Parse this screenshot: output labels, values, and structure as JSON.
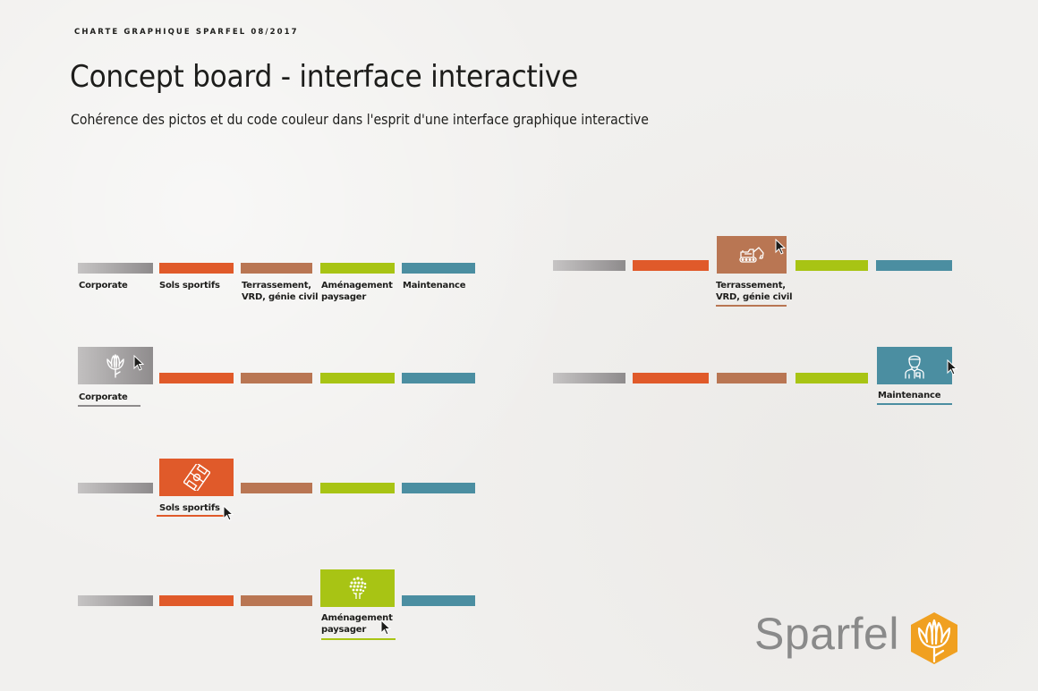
{
  "header": {
    "kicker": "CHARTE GRAPHIQUE SPARFEL 08/2017",
    "title": "Concept board - interface interactive",
    "subtitle": "Cohérence des pictos et du code couleur dans l'esprit d'une interface graphique interactive"
  },
  "colors": {
    "corporate": "#8e8b8c",
    "sols_sportifs": "#e05a2a",
    "terrassement": "#b97653",
    "amenagement": "#a8c414",
    "maintenance": "#4b8ea1",
    "logo_orange": "#f0a020",
    "logo_grey": "#8a8a8a"
  },
  "categories": [
    {
      "key": "corporate",
      "label": "Corporate"
    },
    {
      "key": "sols",
      "label": "Sols sportifs"
    },
    {
      "key": "terr",
      "label": "Terrassement,\nVRD, génie civil"
    },
    {
      "key": "amen",
      "label": "Aménagement\npaysager"
    },
    {
      "key": "maint",
      "label": "Maintenance"
    }
  ],
  "states": [
    {
      "name": "overview",
      "active": null
    },
    {
      "name": "corporate-active",
      "active": "corporate",
      "icon": "flower-icon"
    },
    {
      "name": "sols-active",
      "active": "sols",
      "icon": "football-field-icon"
    },
    {
      "name": "amen-active",
      "active": "amen",
      "icon": "tree-icon"
    },
    {
      "name": "terr-active",
      "active": "terr",
      "icon": "excavator-icon"
    },
    {
      "name": "maint-active",
      "active": "maint",
      "icon": "technician-icon"
    }
  ],
  "logo": {
    "text": "Sparfel"
  }
}
